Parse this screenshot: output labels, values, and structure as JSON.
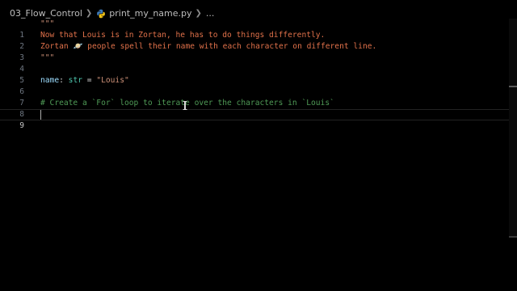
{
  "breadcrumb": {
    "folder": "03_Flow_Control",
    "file": "print_my_name.py",
    "more": "..."
  },
  "icons": {
    "separator": "chevron-right-icon",
    "file_type": "python-icon",
    "emoji": "ringed-planet-icon"
  },
  "colors": {
    "background": "#000000",
    "string": "#ce9178",
    "docstring": "#e0714a",
    "variable": "#9cdcfe",
    "type": "#4ec9b0",
    "comment": "#4f9a56",
    "line_number": "#6e7681"
  },
  "code": {
    "line_numbers": [
      "1",
      "2",
      "3",
      "4",
      "5",
      "6",
      "7",
      "8",
      "9"
    ],
    "l1": "\"\"\"",
    "l2": "Now that Louis is in Zortan, he has to do things differently.",
    "l3a": "Zortan ",
    "l3emoji": "🪐",
    "l3b": " people spell their name with each character on different line.",
    "l4": "\"\"\"",
    "l6_name": "name",
    "l6_colon": ": ",
    "l6_type": "str",
    "l6_eq": " = ",
    "l6_value": "\"Louis\"",
    "l8": "# Create a `For` loop to iterate over the characters in `Louis`",
    "current_line": "9"
  }
}
